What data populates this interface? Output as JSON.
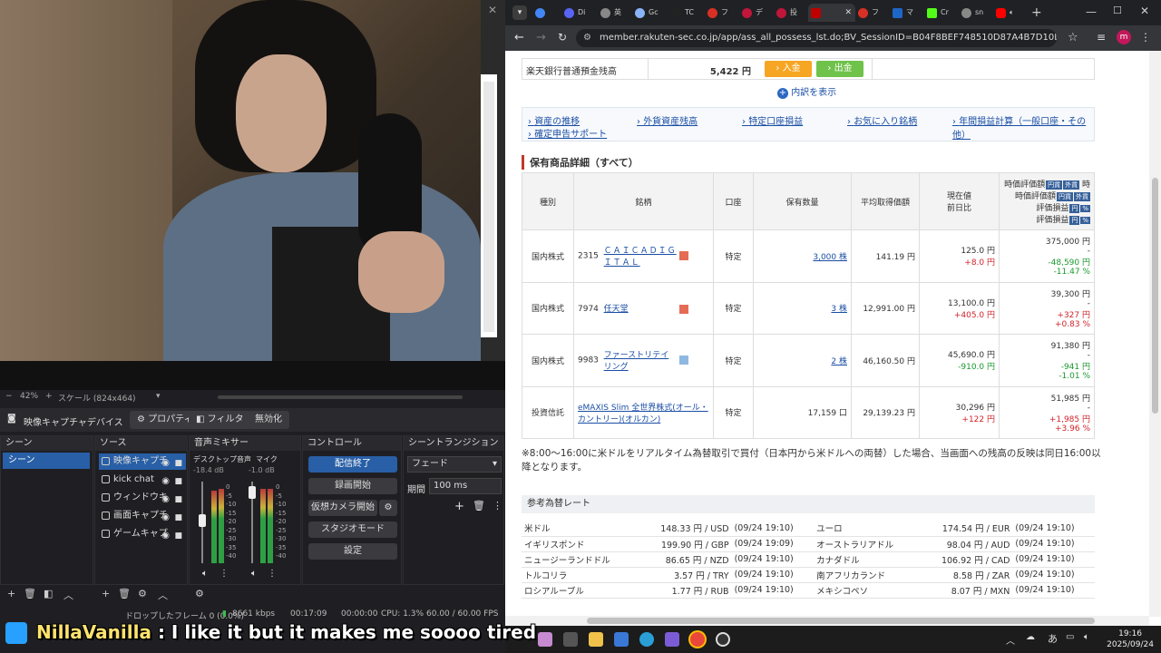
{
  "obs": {
    "zoom": "42%",
    "scale_label": "スケール (824x464)",
    "source_toolbar": {
      "source_name": "映像キャプチャデバイス",
      "properties": "プロパティ",
      "filters": "フィルタ",
      "deactivate": "無効化"
    },
    "docks": {
      "scenes": "シーン",
      "sources": "ソース",
      "mixer": "音声ミキサー",
      "controls": "コントロール",
      "transitions": "シーントランジション"
    },
    "scenes": [
      "シーン"
    ],
    "sources": [
      "映像キャプチ",
      "kick chat",
      "ウィンドウキ",
      "画面キャプチ",
      "ゲームキャプ"
    ],
    "mixer": [
      {
        "name": "デスクトップ音声",
        "db": "-18.4 dB"
      },
      {
        "name": "マイク",
        "db": "-1.0 dB"
      }
    ],
    "scale_ticks": [
      "0",
      "-5",
      "-10",
      "-15",
      "-20",
      "-25",
      "-30",
      "-35",
      "-40",
      "-45",
      "-50",
      "-55",
      "-60"
    ],
    "controls": [
      "配信終了",
      "録画開始",
      "仮想カメラ開始",
      "スタジオモード",
      "設定"
    ],
    "transition": {
      "type": "フェード",
      "period_label": "期間",
      "period": "100 ms"
    },
    "status": {
      "dropped": "ドロップしたフレーム 0 (0.0%)",
      "kbps": "8661 kbps",
      "time1": "00:17:09",
      "time2": "00:00:00",
      "cpu": "CPU: 1.3%",
      "fps": "60.00 / 60.00 FPS"
    }
  },
  "browser": {
    "tabs": [
      "Di",
      "英",
      "Gc",
      "TC",
      "フ",
      "デ",
      "投",
      "",
      "フ",
      "マ",
      "Cr",
      "sn",
      ""
    ],
    "url": "member.rakuten-sec.co.jp/app/ass_all_possess_lst.do;BV_SessionID=B04F8BEF748510D87A4B7D10D8115183.7c3e2565?e...",
    "profile": "m"
  },
  "page": {
    "bank_label": "楽天銀行普通預金残高",
    "bank_value": "5,422 円",
    "deposit": "入金",
    "withdraw": "出金",
    "breakdown": "内訳を表示",
    "links": [
      "資産の推移",
      "外貨資産残高",
      "特定口座損益",
      "お気に入り銘柄",
      "年間損益計算（一般口座・その他）",
      "確定申告サポート"
    ],
    "section_title": "保有商品詳細（すべて）",
    "headers": {
      "type": "種別",
      "name": "銘柄",
      "account": "口座",
      "qty": "保有数量",
      "avg": "平均取得価額",
      "price": "現在値",
      "prev": "前日比",
      "eval1": "時価評価額",
      "eval2": "評価損益",
      "yen": "円貨",
      "fx": "外貨",
      "yen2": "円",
      "pct": "%",
      "time": "時"
    },
    "rows": [
      {
        "type": "国内株式",
        "code": "2315",
        "name": "ＣＡＩＣＡＤＩＧＩＴＡＬ",
        "account": "特定",
        "qty": "3,000 株",
        "avg": "141.19 円",
        "price": "125.0 円",
        "change": "+8.0 円",
        "value": "375,000 円",
        "dash": "-",
        "pl": "-48,590 円",
        "plpct": "-11.47 %",
        "chg_class": "pos",
        "pl_class": "neg"
      },
      {
        "type": "国内株式",
        "code": "7974",
        "name": "任天堂",
        "account": "特定",
        "qty": "3 株",
        "avg": "12,991.00 円",
        "price": "13,100.0 円",
        "change": "+405.0 円",
        "value": "39,300 円",
        "dash": "-",
        "pl": "+327 円",
        "plpct": "+0.83 %",
        "chg_class": "pos",
        "pl_class": "pos"
      },
      {
        "type": "国内株式",
        "code": "9983",
        "name": "ファーストリテイリング",
        "account": "特定",
        "qty": "2 株",
        "avg": "46,160.50 円",
        "price": "45,690.0 円",
        "change": "-910.0 円",
        "value": "91,380 円",
        "dash": "-",
        "pl": "-941 円",
        "plpct": "-1.01 %",
        "chg_class": "neg",
        "pl_class": "neg"
      },
      {
        "type": "投資信託",
        "code": "",
        "name": "eMAXIS Slim 全世界株式(オール・カントリー)(オルカン)",
        "account": "特定",
        "qty": "17,159 口",
        "avg": "29,139.23 円",
        "price": "30,296 円",
        "change": "+122 円",
        "value": "51,985 円",
        "dash": "-",
        "pl": "+1,985 円",
        "plpct": "+3.96 %",
        "chg_class": "pos",
        "pl_class": "pos"
      }
    ],
    "note": "※8:00～16:00に米ドルをリアルタイム為替取引で買付（日本円から米ドルへの両替）した場合、当画面への残高の反映は同日16:00以降となります。",
    "fx_title": "参考為替レート",
    "fx": [
      [
        "米ドル",
        "148.33 円 / USD",
        "(09/24 19:10)",
        "ユーロ",
        "174.54 円 / EUR",
        "(09/24 19:10)"
      ],
      [
        "イギリスポンド",
        "199.90 円 / GBP",
        "(09/24 19:09)",
        "オーストラリアドル",
        "98.04 円 / AUD",
        "(09/24 19:10)"
      ],
      [
        "ニュージーランドドル",
        "86.65 円 / NZD",
        "(09/24 19:10)",
        "カナダドル",
        "106.92 円 / CAD",
        "(09/24 19:10)"
      ],
      [
        "トルコリラ",
        "3.57 円 / TRY",
        "(09/24 19:10)",
        "南アフリカランド",
        "8.58 円 / ZAR",
        "(09/24 19:10)"
      ],
      [
        "ロシアルーブル",
        "1.77 円 / RUB",
        "(09/24 19:10)",
        "メキシコペソ",
        "8.07 円 / MXN",
        "(09/24 19:10)"
      ]
    ]
  },
  "taskbar": {
    "time": "19:16",
    "date": "2025/09/24",
    "ime": "あ"
  },
  "chat": {
    "user": "NillaVanilla",
    "message": " : I like it but it makes me soooo tired"
  }
}
